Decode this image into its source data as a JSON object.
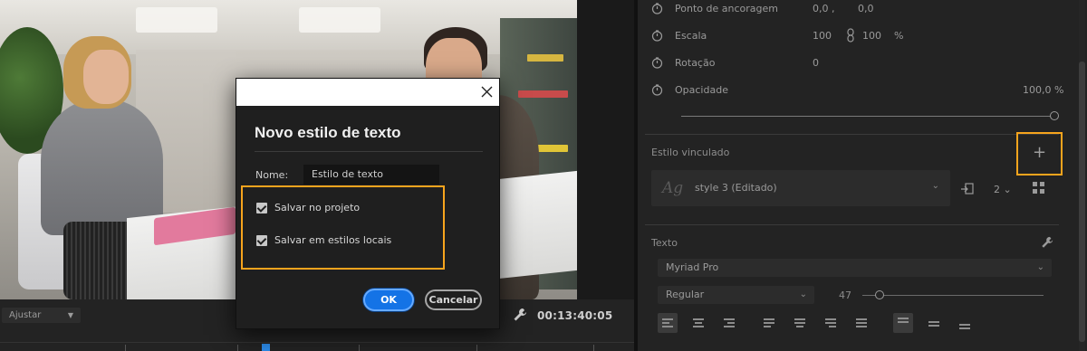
{
  "monitor": {
    "fit_label": "Ajustar",
    "timecode": "00:13:40:05"
  },
  "panel": {
    "properties": [
      {
        "label": "Ponto de ancoragem",
        "value1": "0,0 ,",
        "value2": "0,0"
      },
      {
        "label": "Escala",
        "value1": "100",
        "value2": "100",
        "unit": "%"
      },
      {
        "label": "Rotação",
        "value1": "0"
      },
      {
        "label": "Opacidade",
        "value1": "100,0 %"
      }
    ],
    "linked_style": {
      "title": "Estilo vinculado",
      "add_symbol": "+",
      "selected": "style 3 (Editado)",
      "preview_glyph": "Ag",
      "count": "2"
    },
    "text_section": {
      "title": "Texto",
      "font": "Myriad Pro",
      "weight": "Regular",
      "size": "47"
    }
  },
  "dialog": {
    "title": "Novo estilo de texto",
    "name_label": "Nome:",
    "name_value": "Estilo de texto",
    "checkboxes": [
      {
        "label": "Salvar no projeto",
        "checked": true
      },
      {
        "label": "Salvar em estilos locais",
        "checked": true
      }
    ],
    "ok_label": "OK",
    "cancel_label": "Cancelar"
  },
  "colors": {
    "accent_highlight": "#f7a41d",
    "primary_button": "#1473e6",
    "playhead": "#2d8ceb"
  }
}
